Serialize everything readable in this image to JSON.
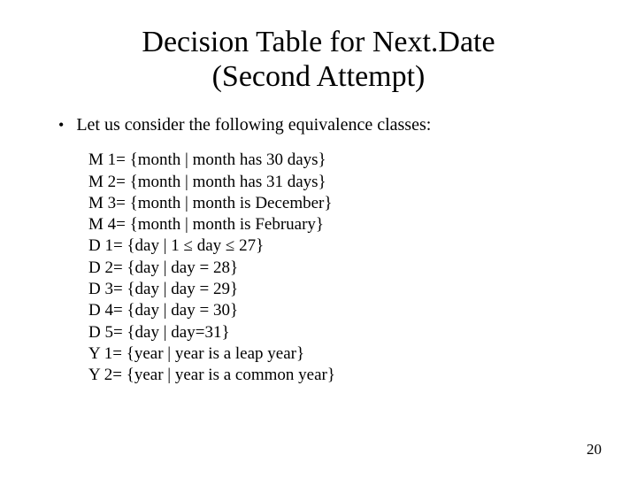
{
  "title_line1": "Decision Table for Next.Date",
  "title_line2": "(Second Attempt)",
  "bullet": "Let us consider the following equivalence classes:",
  "classes": [
    "M 1= {month | month has 30 days}",
    "M 2= {month | month has 31 days}",
    "M 3= {month | month is December}",
    "M 4= {month | month is February}",
    "D 1= {day | 1 ≤ day ≤ 27}",
    "D 2= {day | day = 28}",
    "D 3= {day | day = 29}",
    "D 4= {day | day = 30}",
    "D 5= {day | day=31}",
    "Y 1= {year | year is a leap year}",
    "Y 2= {year | year is a common year}"
  ],
  "page_number": "20"
}
